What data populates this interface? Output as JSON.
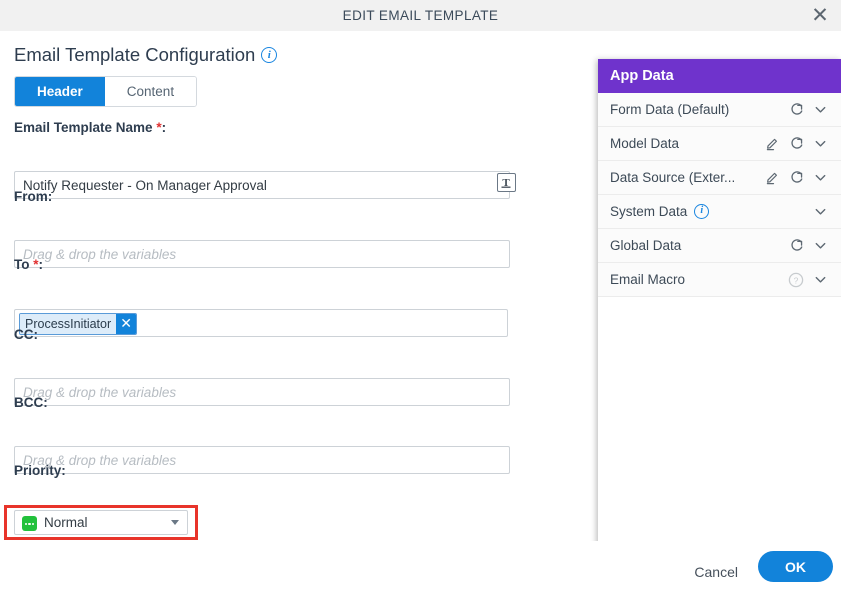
{
  "titlebar": {
    "title": "EDIT EMAIL TEMPLATE",
    "close_label": "✕"
  },
  "dialog": {
    "section_title": "Email Template Configuration",
    "info_icon_label": "i",
    "tabs": [
      {
        "label": "Header",
        "active": true
      },
      {
        "label": "Content",
        "active": false
      }
    ],
    "fields": [
      {
        "label": "Email Template Name",
        "required": true,
        "value": "Notify Requester - On Manager Approval",
        "placeholder": ""
      },
      {
        "label": "From",
        "required": false,
        "value": "",
        "placeholder": "Drag & drop the variables"
      },
      {
        "label": "To",
        "required": true,
        "chip": "ProcessInitiator",
        "chip_close_label": "✕"
      },
      {
        "label": "CC",
        "required": false,
        "value": "",
        "placeholder": "Drag & drop the variables"
      },
      {
        "label": "BCC",
        "required": false,
        "value": "",
        "placeholder": "Drag & drop the variables"
      }
    ],
    "priority": {
      "label": "Priority",
      "selected": "Normal",
      "icon_color": "#22c13c",
      "highlight_color": "#e8342a"
    },
    "required_marker": "*",
    "colon": ":"
  },
  "app_data": {
    "header": "App Data",
    "header_color": "#6f33cc",
    "rows": [
      {
        "label": "Form Data (Default)",
        "edit": false,
        "refresh": true,
        "info": false,
        "help": false,
        "expand": true
      },
      {
        "label": "Model Data",
        "edit": true,
        "refresh": true,
        "info": false,
        "help": false,
        "expand": true
      },
      {
        "label": "Data Source (Exter...",
        "edit": true,
        "refresh": true,
        "info": false,
        "help": false,
        "expand": true
      },
      {
        "label": "System Data",
        "edit": false,
        "refresh": false,
        "info": true,
        "help": false,
        "expand": true
      },
      {
        "label": "Global Data",
        "edit": false,
        "refresh": true,
        "info": false,
        "help": false,
        "expand": true
      },
      {
        "label": "Email Macro",
        "edit": false,
        "refresh": false,
        "info": false,
        "help": true,
        "expand": true
      }
    ],
    "info_icon_label": "i",
    "help_icon_label": "?"
  },
  "footer": {
    "cancel_label": "Cancel",
    "ok_label": "OK",
    "accent_color": "#1283da"
  }
}
